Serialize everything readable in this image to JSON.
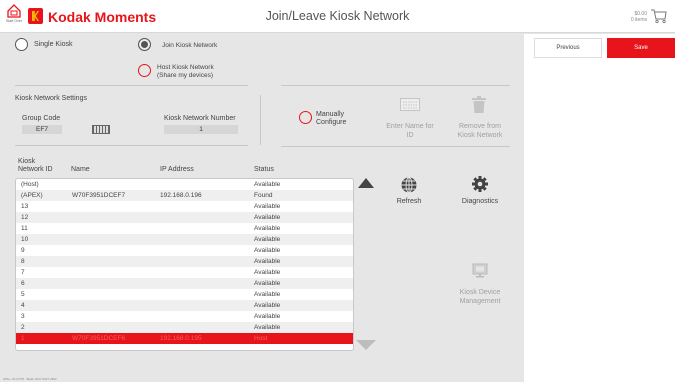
{
  "header": {
    "home_label": "Start Over",
    "brand": "Kodak Moments",
    "title": "Join/Leave Kiosk Network",
    "cart_total": "$0.00",
    "cart_items": "0 items"
  },
  "actions": {
    "previous": "Previous",
    "save": "Save"
  },
  "modes": {
    "single": "Single Kiosk",
    "join": "Join Kiosk Network",
    "host_line1": "Host Kiosk Network",
    "host_line2": "(Share my devices)"
  },
  "settings": {
    "section_title": "Kiosk Network Settings",
    "group_code_label": "Group Code",
    "group_code_value": "EF7",
    "network_number_label": "Kiosk Network Number",
    "network_number_value": "1",
    "manual_line1": "Manually",
    "manual_line2": "Configure",
    "enter_name_line1": "Enter Name for",
    "enter_name_line2": "ID",
    "remove_line1": "Remove from",
    "remove_line2": "Kiosk Network"
  },
  "table": {
    "headers": {
      "id_line1": "Kiosk",
      "id_line2": "Network ID",
      "name": "Name",
      "ip": "IP Address",
      "status": "Status"
    },
    "rows": [
      {
        "id": "(Host)",
        "name": "",
        "ip": "",
        "status": "Available"
      },
      {
        "id": "(APEX)",
        "name": "W70F3951DCEF7",
        "ip": "192.168.0.196",
        "status": "Found"
      },
      {
        "id": "13",
        "name": "",
        "ip": "",
        "status": "Available"
      },
      {
        "id": "12",
        "name": "",
        "ip": "",
        "status": "Available"
      },
      {
        "id": "11",
        "name": "",
        "ip": "",
        "status": "Available"
      },
      {
        "id": "10",
        "name": "",
        "ip": "",
        "status": "Available"
      },
      {
        "id": "9",
        "name": "",
        "ip": "",
        "status": "Available"
      },
      {
        "id": "8",
        "name": "",
        "ip": "",
        "status": "Available"
      },
      {
        "id": "7",
        "name": "",
        "ip": "",
        "status": "Available"
      },
      {
        "id": "6",
        "name": "",
        "ip": "",
        "status": "Available"
      },
      {
        "id": "5",
        "name": "",
        "ip": "",
        "status": "Available"
      },
      {
        "id": "4",
        "name": "",
        "ip": "",
        "status": "Available"
      },
      {
        "id": "3",
        "name": "",
        "ip": "",
        "status": "Available"
      },
      {
        "id": "2",
        "name": "",
        "ip": "",
        "status": "Available"
      },
      {
        "id": "1",
        "name": "W70F3951DCEF6",
        "ip": "192.168.0.195",
        "status": "Host"
      }
    ]
  },
  "tools": {
    "refresh": "Refresh",
    "diagnostics": "Diagnostics",
    "device_mgmt_line1": "Kiosk Device",
    "device_mgmt_line2": "Management"
  },
  "footer": "APK+ V6.0 P78 · Build: 2017.0327.2302",
  "colors": {
    "accent": "#e8141b",
    "logo_inner": "#f6b700",
    "background": "#e6e6e6"
  }
}
